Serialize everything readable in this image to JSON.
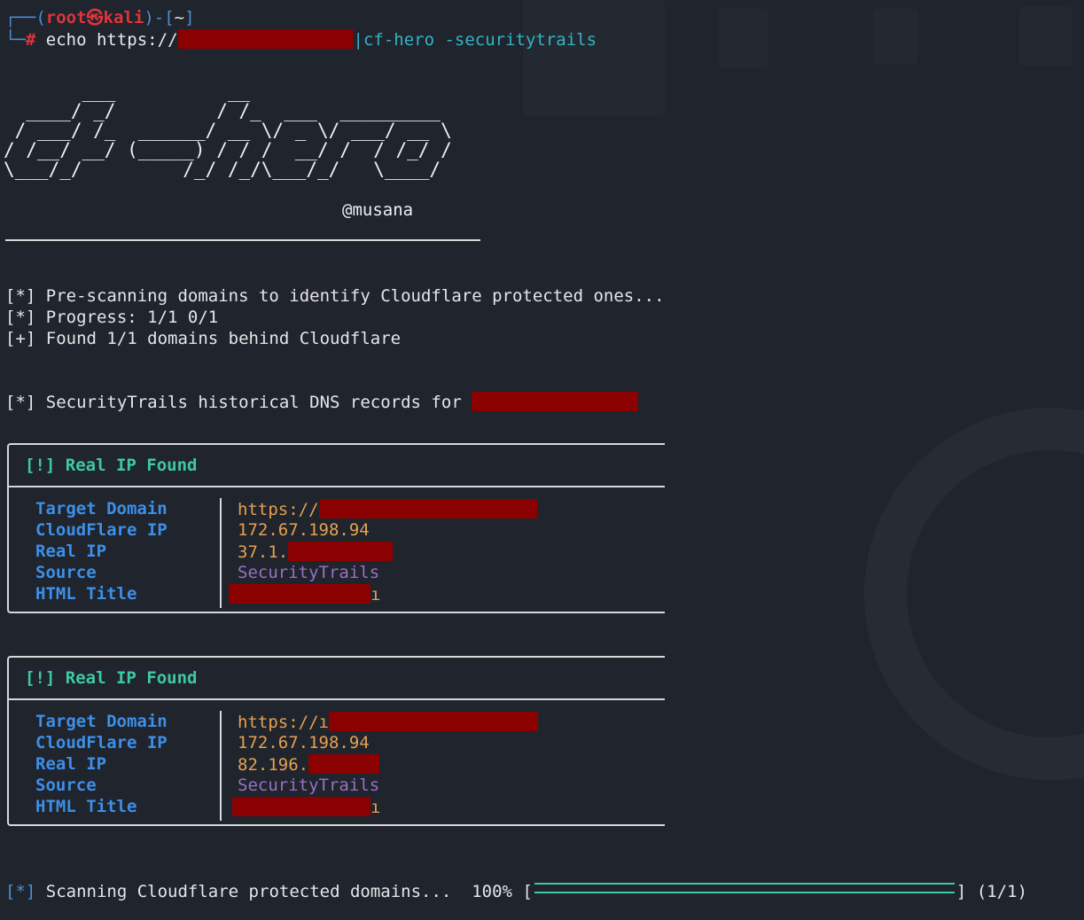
{
  "prompt": {
    "user": "root",
    "host": "kali",
    "at_symbol": "㉿",
    "dir": "~",
    "symbol": "#",
    "command_prefix": "echo https://",
    "pipe": "|",
    "command_suffix": "cf-hero -securitytrails"
  },
  "banner": {
    "ascii": "       ___          __\n  ____/ _/         / /_  ___  _________\n / ___/ /_  ______/ __ \\/ _ \\/ ___/ __ \\\n/ /__/ __/ (_____) / / /  __/ /  / /_/ /\n\\___/_/         /_/ /_/\\___/_/   \\____/",
    "author": "@musana"
  },
  "log": [
    "[*] Pre-scanning domains to identify Cloudflare protected ones...",
    "[*] Progress: 1/1 0/1",
    "[+] Found 1/1 domains behind Cloudflare"
  ],
  "history_line": "[*] SecurityTrails historical DNS records for ",
  "results": [
    {
      "title": "[!] Real IP Found",
      "labels": [
        "Target Domain",
        "CloudFlare IP",
        "Real IP",
        "Source",
        "HTML Title"
      ],
      "target_domain_prefix": "https://",
      "cloudflare_ip": "172.67.198.94",
      "real_ip_prefix": "37.1.",
      "source": "SecurityTrails",
      "html_title_suffix": "ı"
    },
    {
      "title": "[!] Real IP Found",
      "labels": [
        "Target Domain",
        "CloudFlare IP",
        "Real IP",
        "Source",
        "HTML Title"
      ],
      "target_domain_prefix": "https://ı",
      "cloudflare_ip": "172.67.198.94",
      "real_ip_prefix": "82.196.",
      "source": "SecurityTrails",
      "html_title_suffix": "ı"
    }
  ],
  "progress": {
    "prefix": "[*]",
    "text": "Scanning Cloudflare protected domains...",
    "percent": "100%",
    "fraction": 1.0,
    "open_bracket": "[",
    "close_bracket": "]",
    "count": "(1/1)"
  },
  "colors": {
    "background": "#1f242d",
    "prompt_red": "#e0333a",
    "prompt_blue": "#4e8fd6",
    "accent_green": "#3fc9a1",
    "label_blue": "#3d8fe8",
    "value_orange": "#e7a050",
    "value_purple": "#9b6fc5",
    "redaction": "#8b0000"
  }
}
